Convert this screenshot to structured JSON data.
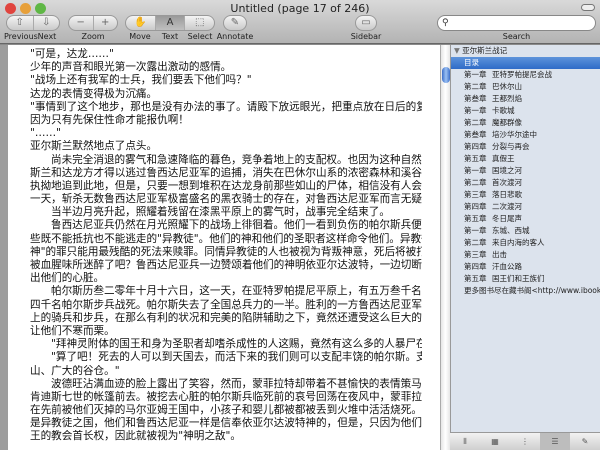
{
  "window": {
    "title": "Untitled (page 17 of 246)"
  },
  "toolbar": {
    "previous": "Previous",
    "next": "Next",
    "zoom": "Zoom",
    "move": "Move",
    "text": "Text",
    "select": "Select",
    "annotate": "Annotate",
    "sidebar": "Sidebar",
    "search": "Search",
    "search_value": "",
    "active_tool": "Text"
  },
  "document": {
    "paragraphs": [
      {
        "indent": false,
        "lines": [
          "\"可是，达龙……\""
        ]
      },
      {
        "indent": false,
        "lines": [
          "少年的声音和眼光第一次露出激动的感情。"
        ]
      },
      {
        "indent": false,
        "lines": [
          "\"战场上还有我军的士兵，我们要丢下他们吗？\""
        ]
      },
      {
        "indent": false,
        "lines": [
          "达龙的表情变得极为沉痛。"
        ]
      },
      {
        "indent": false,
        "lines": [
          "\"事情到了这个地步，那也是没有办法的事了。请殿下放远眼光，把重点放在日后的复仇吧！\""
        ]
      },
      {
        "indent": false,
        "lines": [
          "因为只有先保住性命才能报仇啊！"
        ]
      },
      {
        "indent": false,
        "lines": [
          "\"……\""
        ]
      },
      {
        "indent": false,
        "lines": [
          "亚尔斯兰默然地点了点头。"
        ]
      },
      {
        "indent": true,
        "lines": [
          "尚未完全消退的雾气和急速降临的暮色，竞争着地上的支配权。也因为这种自然条件的庇护，亚尔",
          "斯兰和达龙方才得以逃过鲁西达尼亚军的追捕，消失在巴休尔山系的浓密森林和溪谷当中。就算有敌人",
          "执拗地追到此地，但是，只要一想到堆积在达龙身前那些如山的尸体，相信没有人会不感到战栗的。这",
          "一天，斩杀无数鲁西达尼亚军极富盛名的黑衣骑士的存在，对鲁西达尼亚军而言无疑是一场噩梦。"
        ]
      },
      {
        "indent": true,
        "lines": [
          "当半边月亮升起，照耀着残留在漆黑平原上的雾气时，战事完全结束了。"
        ]
      },
      {
        "indent": true,
        "lines": [
          "鲁西达尼亚兵仍然在月光照耀下的战场上徘徊着。他们一看到负伤的帕尔斯兵便毫不留情地击杀这",
          "些既不能抵抗也不能逃走的\"异教徒\"。他们的神和他们的圣职者这样命令他们。异教徒背叛\"唯一绝对的",
          "神\"的罪只能用最残酷的死法来赎罪。同情异教徒的人也被视为背叛神意，死后将被打下地狱。或许是",
          "被血腥味所迷醉了吧？鲁西达尼亚兵一边赞颂着他们的神明依亚尔达波特，一边切断负伤者的咽喉，挖",
          "出他们的心脏。"
        ]
      },
      {
        "indent": true,
        "lines": [
          "帕尔斯历叁二零年十月十六日，这一天，在亚特罗帕提尼平原上，有五万叁千名帕尔斯骑兵和七万",
          "四千名帕尔斯步兵战死。帕尔斯失去了全国总兵力的一半。胜利的一方鲁西达尼亚军也损失了五万名以",
          "上的骑兵和步兵，在那么有利的状况和完美的陷阱辅助之下，竟然还遭受这么巨大的打击，这件事不禁",
          "让他们不寒而栗。"
        ]
      },
      {
        "indent": true,
        "lines": [
          "\"拜神灵附体的国王和身为圣职者却嗜杀成性的人这赐，竟然有这么多的人暴尸在异国的土地上。\""
        ]
      },
      {
        "indent": true,
        "lines": [
          "\"算了吧！死去的人可以到天国去，而活下来的我们则可以支配丰饶的帕尔斯。支配大陆公路和银",
          "山、广大的谷仓。\""
        ]
      },
      {
        "indent": true,
        "lines": [
          "波德旺沾满血迹的脸上露出了笑容，然而，蒙菲拉特却带着不甚愉快的表情策马朝他们的国王伊诺",
          "肯迪斯七世的帐篷前去。被挖去心脏的帕尔斯兵临死前的哀号回荡在夜风中，蒙菲拉特不禁吓了一跳。",
          "在先前被他们灭掉的马尔亚姆王国中，小孩子和婴儿都被都被丢到火堆中活活烧死。马尔亚姆王国并不",
          "是异教徒之国，他们和鲁西达尼亚一样是信奉依亚尔达波特神的，但是，只因为他们不承认鲁西达尼亚",
          "王的教会首长权，因此就被视为\"神明之敌\"。"
        ]
      }
    ]
  },
  "sidebar": {
    "root": "亚尔斯兰战记",
    "items": [
      {
        "ch": "目录",
        "title": "",
        "selected": true
      },
      {
        "ch": "第一章",
        "title": "亚特罗帕提尼会战"
      },
      {
        "ch": "第二章",
        "title": "巴休尔山"
      },
      {
        "ch": "第叁章",
        "title": "王都烈焰"
      },
      {
        "ch": "第一章",
        "title": "卡歌城"
      },
      {
        "ch": "第二章",
        "title": "魔都群像"
      },
      {
        "ch": "第叁章",
        "title": "培沙华尔途中"
      },
      {
        "ch": "第四章",
        "title": "分裂与再会"
      },
      {
        "ch": "第五章",
        "title": "真假王"
      },
      {
        "ch": "第一章",
        "title": "国境之河"
      },
      {
        "ch": "第二章",
        "title": "首次渡河"
      },
      {
        "ch": "第三章",
        "title": "落日悲歌"
      },
      {
        "ch": "第四章",
        "title": "二次渡河"
      },
      {
        "ch": "第五章",
        "title": "冬日尾声"
      },
      {
        "ch": "第一章",
        "title": "东城、西城"
      },
      {
        "ch": "第二章",
        "title": "来自内海的客人"
      },
      {
        "ch": "第三章",
        "title": "出击"
      },
      {
        "ch": "第四章",
        "title": "汗血公路"
      },
      {
        "ch": "第五章",
        "title": "国王们和王族们"
      },
      {
        "ch": "更多图书尽在藏书阁<http://www.ibook...",
        "title": ""
      }
    ]
  },
  "colors": {
    "selection": "#3a75cc",
    "sidebar_bg": "#dce3ed"
  }
}
